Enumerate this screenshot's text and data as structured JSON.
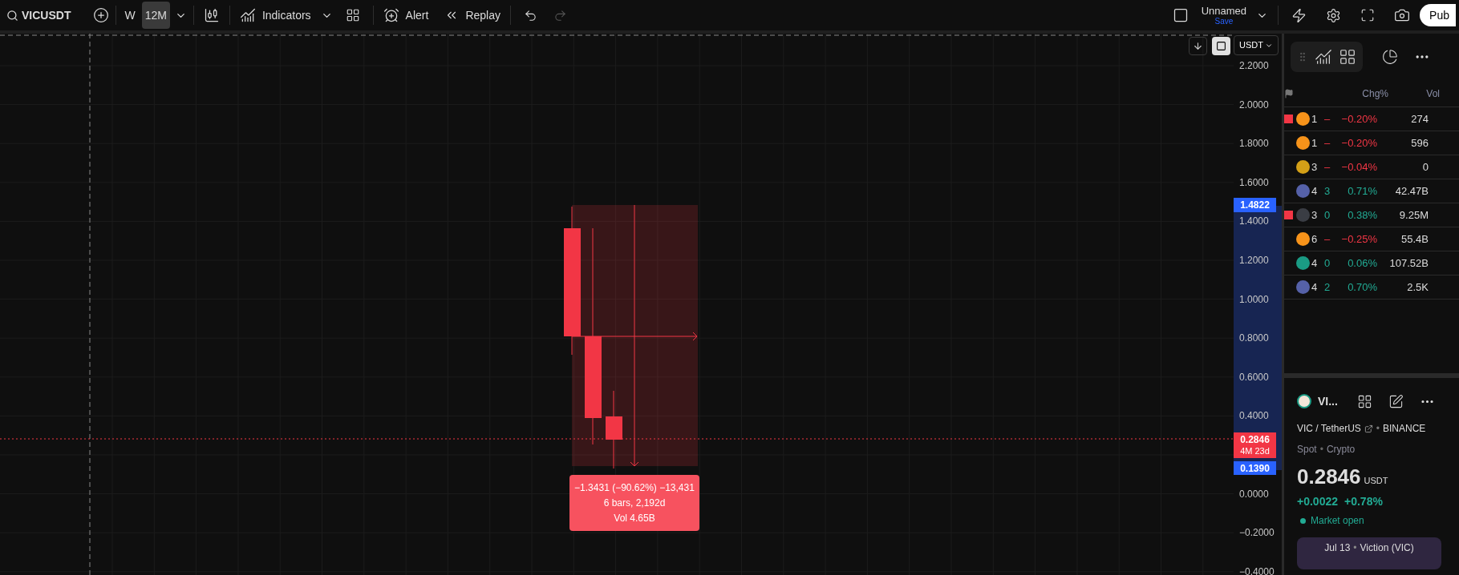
{
  "toolbar": {
    "symbol": "VICUSDT",
    "intervals": [
      {
        "label": "W",
        "selected": false
      },
      {
        "label": "12M",
        "selected": true
      }
    ],
    "indicators": "Indicators",
    "alert": "Alert",
    "replay": "Replay",
    "undo_disabled": false,
    "redo_disabled": true,
    "layout_name": "Unnamed",
    "save": "Save",
    "publish": "Pub"
  },
  "chart": {
    "currency": "USDT",
    "auto_scale_on": true,
    "price_axis": [
      "2.2000",
      "2.0000",
      "1.8000",
      "1.6000",
      "1.4000",
      "1.2000",
      "1.0000",
      "0.8000",
      "0.6000",
      "0.4000",
      "0.0000",
      "−0.2000",
      "−0.4000"
    ],
    "high_tag": "1.4822",
    "low_tag": "0.1390",
    "last_price": "0.2846",
    "countdown": "4M 23d",
    "measure": {
      "change": "−1.3431 (−90.62%) −13,431",
      "bars": "6 bars, 2,192d",
      "volume": "Vol 4.65B"
    }
  },
  "watchlist": {
    "columns": [
      "Chg%",
      "Vol"
    ],
    "rows": [
      {
        "color": "#f7931a",
        "symbol": "1",
        "last": "–",
        "change": "−0.20%",
        "volume": "274",
        "down": true,
        "flagged": true
      },
      {
        "color": "#f7931a",
        "symbol": "1",
        "last": "–",
        "change": "−0.20%",
        "volume": "596",
        "down": true,
        "flagged": false
      },
      {
        "color": "#d4a017",
        "symbol": "3",
        "last": "–",
        "change": "−0.04%",
        "volume": "0",
        "down": true,
        "flagged": false
      },
      {
        "color": "#5561a8",
        "symbol": "4",
        "last": "3",
        "change": "0.71%",
        "volume": "42.47B",
        "down": false,
        "flagged": false
      },
      {
        "color": "#3a3d44",
        "symbol": "3",
        "last": "0",
        "change": "0.38%",
        "volume": "9.25M",
        "down": false,
        "flagged": true
      },
      {
        "color": "#f7931a",
        "symbol": "6",
        "last": "–",
        "change": "−0.25%",
        "volume": "55.4B",
        "down": true,
        "flagged": false
      },
      {
        "color": "#1a9b84",
        "symbol": "4",
        "last": "0",
        "change": "0.06%",
        "volume": "107.52B",
        "down": false,
        "flagged": false
      },
      {
        "color": "#5561a8",
        "symbol": "4",
        "last": "2",
        "change": "0.70%",
        "volume": "2.5K",
        "down": false,
        "flagged": false
      }
    ]
  },
  "details": {
    "separator": "•",
    "short_name": "VI...",
    "pair": "VIC / TetherUS",
    "exchange": "BINANCE",
    "type": "Spot",
    "category": "Crypto",
    "price": "0.2846",
    "currency": "USDT",
    "change": "+0.0022",
    "change_percent": "+0.78%",
    "market_open": true,
    "market_status": "Market open",
    "news": {
      "date": "Jul 13",
      "title": "Viction (VIC)"
    }
  }
}
